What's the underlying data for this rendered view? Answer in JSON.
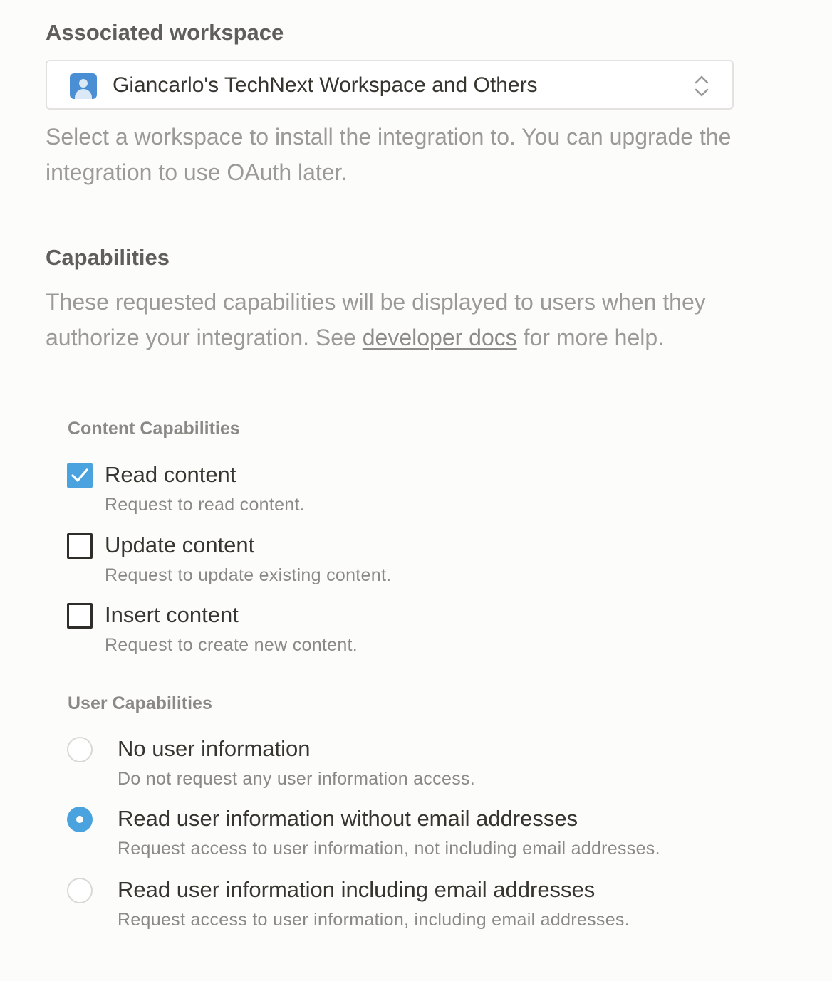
{
  "workspace": {
    "title": "Associated workspace",
    "selected": "Giancarlo's TechNext Workspace and Others",
    "help": "Select a workspace to install the integration to. You can upgrade the integration to use OAuth later.",
    "avatar_icon": "user-avatar-icon",
    "chevron_icon": "chevron-up-down-icon"
  },
  "capabilities": {
    "title": "Capabilities",
    "help_before": "These requested capabilities will be displayed to users when they authorize your integration. See ",
    "help_link": "developer docs",
    "help_after": " for more help.",
    "content": {
      "title": "Content Capabilities",
      "items": [
        {
          "label": "Read content",
          "description": "Request to read content.",
          "checked": true
        },
        {
          "label": "Update content",
          "description": "Request to update existing content.",
          "checked": false
        },
        {
          "label": "Insert content",
          "description": "Request to create new content.",
          "checked": false
        }
      ]
    },
    "user": {
      "title": "User Capabilities",
      "items": [
        {
          "label": "No user information",
          "description": "Do not request any user information access.",
          "selected": false
        },
        {
          "label": "Read user information without email addresses",
          "description": "Request access to user information, not including email addresses.",
          "selected": true
        },
        {
          "label": "Read user information including email addresses",
          "description": "Request access to user information, including email addresses.",
          "selected": false
        }
      ]
    }
  },
  "colors": {
    "accent": "#4aa3df",
    "text": "#37352f",
    "muted": "#9b9a97",
    "background": "#fcfcfb"
  }
}
